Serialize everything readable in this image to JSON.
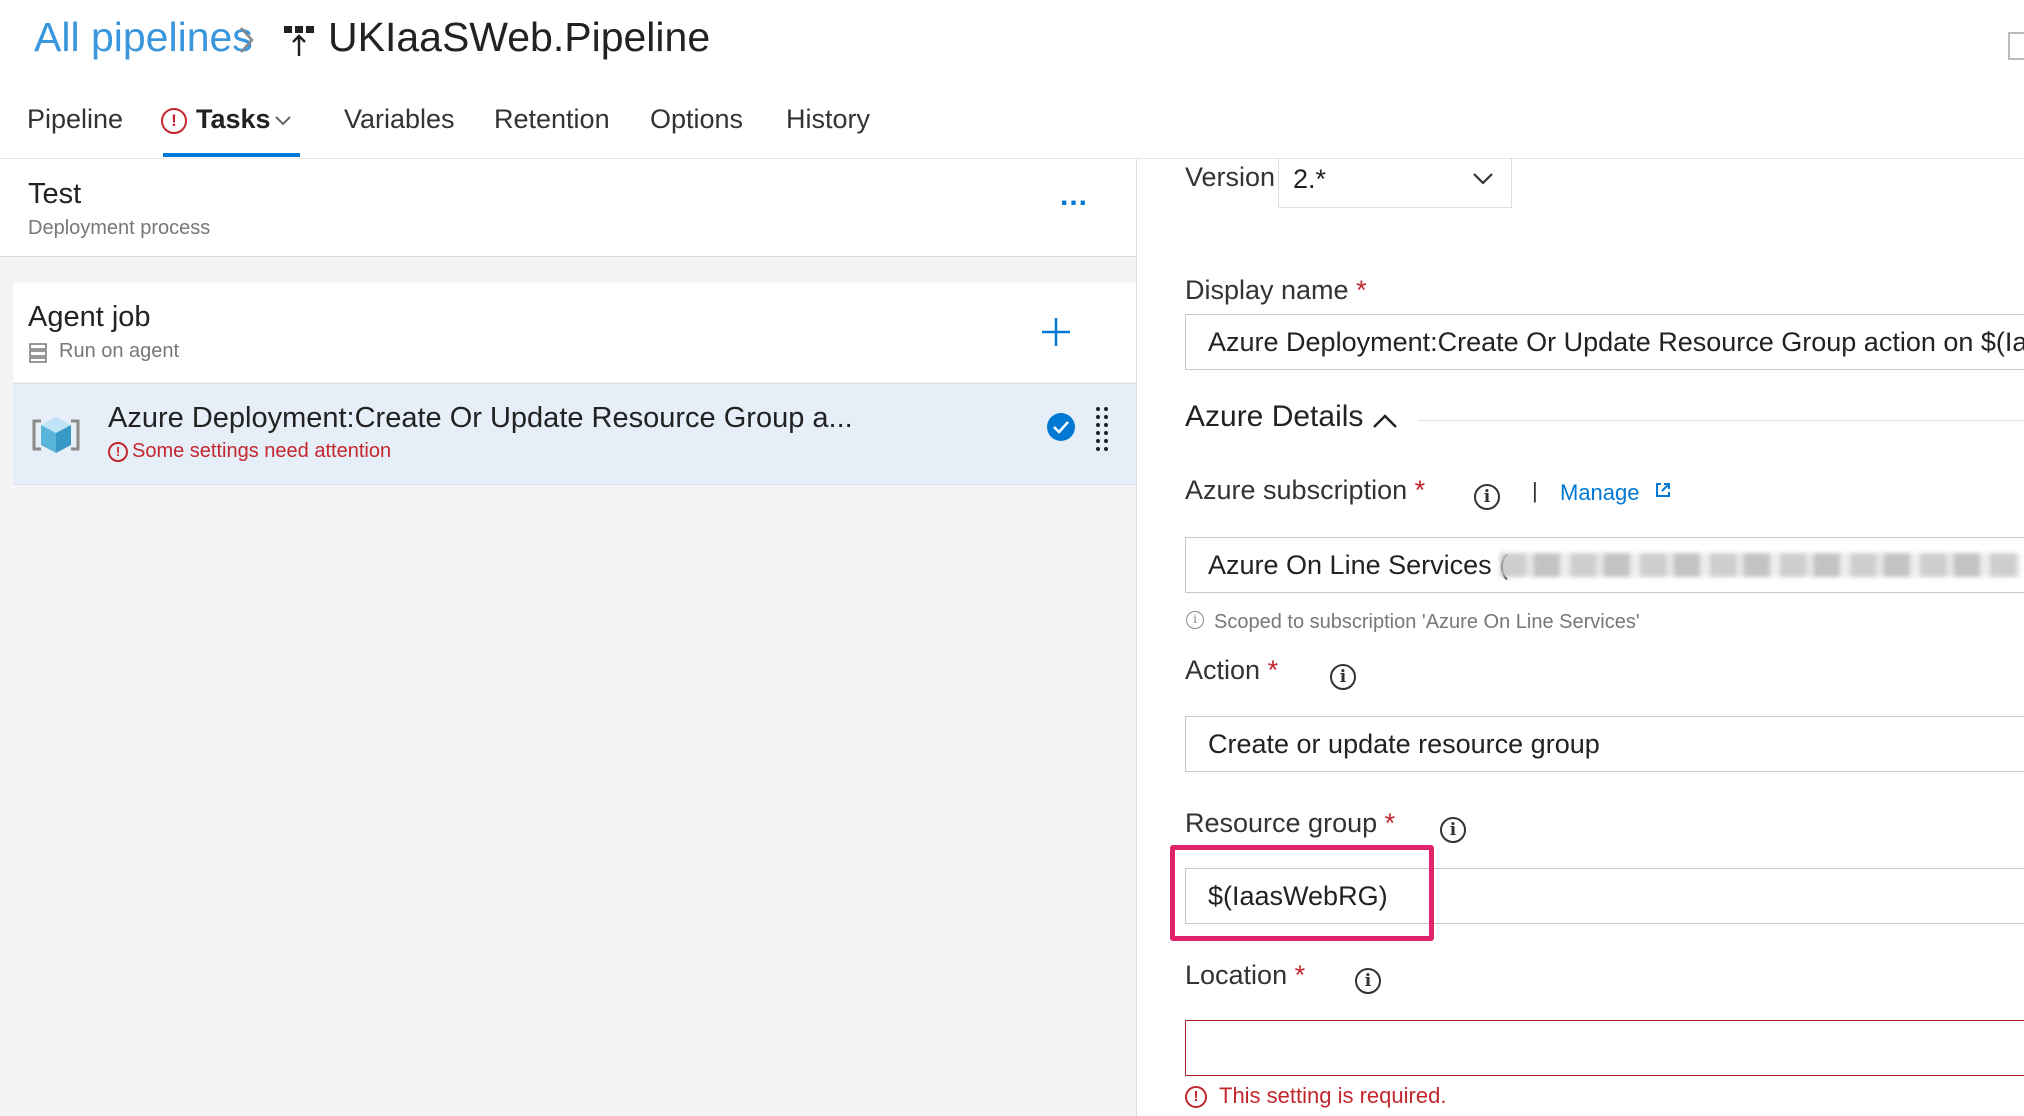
{
  "breadcrumb": {
    "all_pipelines": "All pipelines",
    "pipeline_name": "UKIaaSWeb.Pipeline"
  },
  "tabs": [
    {
      "label": "Pipeline"
    },
    {
      "label": "Tasks",
      "active": true,
      "has_error": true
    },
    {
      "label": "Variables"
    },
    {
      "label": "Retention"
    },
    {
      "label": "Options"
    },
    {
      "label": "History"
    }
  ],
  "stage": {
    "name": "Test",
    "subtitle": "Deployment process",
    "more_label": "..."
  },
  "job": {
    "name": "Agent job",
    "subtitle": "Run on agent"
  },
  "task": {
    "name": "Azure Deployment:Create Or Update Resource Group a...",
    "warning": "Some settings need attention"
  },
  "details": {
    "version_label": "Version",
    "version_value": "2.*",
    "display_name_label": "Display name",
    "display_name_value": "Azure Deployment:Create Or Update Resource Group action on $(Iaas",
    "section_title": "Azure Details",
    "subscription_label": "Azure subscription",
    "manage_label": "Manage",
    "subscription_value": "Azure On Line Services (",
    "subscription_note": "Scoped to subscription 'Azure On Line Services'",
    "action_label": "Action",
    "action_value": "Create or update resource group",
    "resource_group_label": "Resource group",
    "resource_group_value": "$(IaasWebRG)",
    "location_label": "Location",
    "location_value": "",
    "location_error": "This setting is required.",
    "required_mark": "*",
    "separator": "|"
  },
  "colors": {
    "accent": "#0078d4",
    "link": "#3a96dd",
    "error": "#c4262e",
    "highlight": "#e0246c"
  }
}
